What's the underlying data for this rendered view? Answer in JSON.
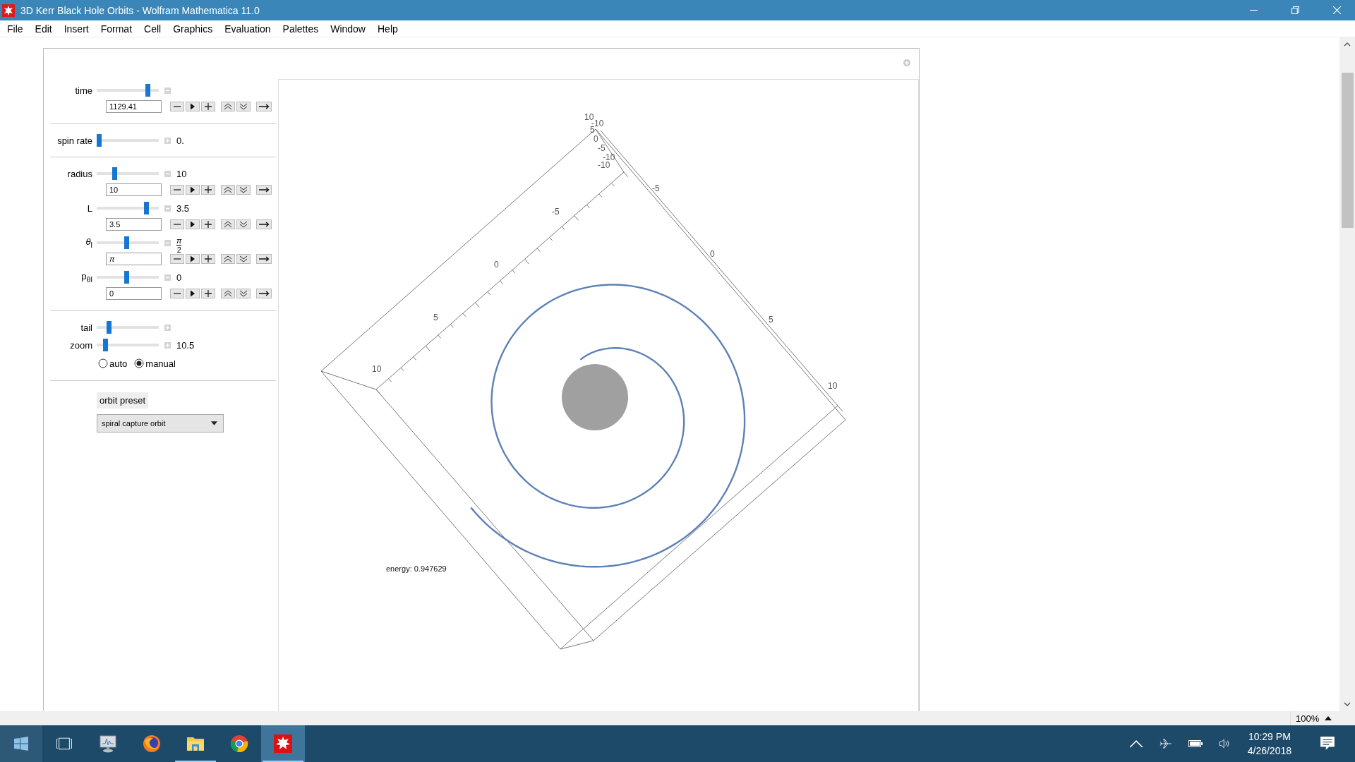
{
  "window": {
    "title": "3D Kerr Black Hole Orbits - Wolfram Mathematica 11.0"
  },
  "menu": [
    "File",
    "Edit",
    "Insert",
    "Format",
    "Cell",
    "Graphics",
    "Evaluation",
    "Palettes",
    "Window",
    "Help"
  ],
  "controls": [
    {
      "kind": "slider",
      "label": "time",
      "expanded": true,
      "level": 0.85,
      "field": "1129.41"
    },
    {
      "kind": "divider"
    },
    {
      "kind": "slider",
      "label": "spin rate",
      "expanded": false,
      "level": 0.0,
      "reading": "0."
    },
    {
      "kind": "divider"
    },
    {
      "kind": "slider",
      "label": "radius",
      "expanded": true,
      "level": 0.27,
      "reading": "10",
      "field": "10"
    },
    {
      "kind": "slider",
      "label": "L",
      "expanded": true,
      "level": 0.83,
      "reading": "3.5",
      "field": "3.5"
    },
    {
      "kind": "slider",
      "label": "*θ*$_{l}$",
      "expanded": true,
      "level": 0.48,
      "fraction": {
        "numerator": "π",
        "denominator": "2"
      },
      "field": "π"
    },
    {
      "kind": "slider",
      "label": "p$_{θl}$",
      "expanded": true,
      "level": 0.48,
      "reading": "0",
      "field": "0"
    },
    {
      "kind": "divider"
    },
    {
      "kind": "slider",
      "label": "tail",
      "expanded": false,
      "level": 0.17
    },
    {
      "kind": "slider",
      "label": "zoom",
      "expanded": false,
      "level": 0.11,
      "reading": "10.5"
    },
    {
      "kind": "radio",
      "options": [
        {
          "label": "auto",
          "selected": false
        },
        {
          "label": "manual",
          "selected": true
        }
      ]
    },
    {
      "kind": "divider"
    },
    {
      "kind": "preset",
      "label": "orbit preset",
      "value": "spiral capture orbit"
    }
  ],
  "plot": {
    "inner_axis_labels": [
      "-5",
      "0",
      "5",
      "10"
    ],
    "right_axis_labels": [
      "-5",
      "0",
      "5",
      "10"
    ],
    "corner_labels": [
      "10",
      "-10",
      "5",
      "0",
      "-5",
      "-10",
      "-10"
    ],
    "annotation": "energy: 0.947629"
  },
  "status_bar": {
    "zoom": "100%"
  },
  "taskbar": {
    "apps": [
      {
        "kind": "start",
        "running": false,
        "active": false
      },
      {
        "kind": "task_view",
        "running": false,
        "active": false
      },
      {
        "kind": "monitor",
        "running": false,
        "active": false
      },
      {
        "kind": "firefox",
        "running": false,
        "active": false
      },
      {
        "kind": "explorer",
        "running": true,
        "active": false
      },
      {
        "kind": "chrome",
        "running": false,
        "active": false
      },
      {
        "kind": "mathematica",
        "running": true,
        "active": true
      }
    ],
    "time": "10:29 PM",
    "date": "4/26/2018"
  }
}
